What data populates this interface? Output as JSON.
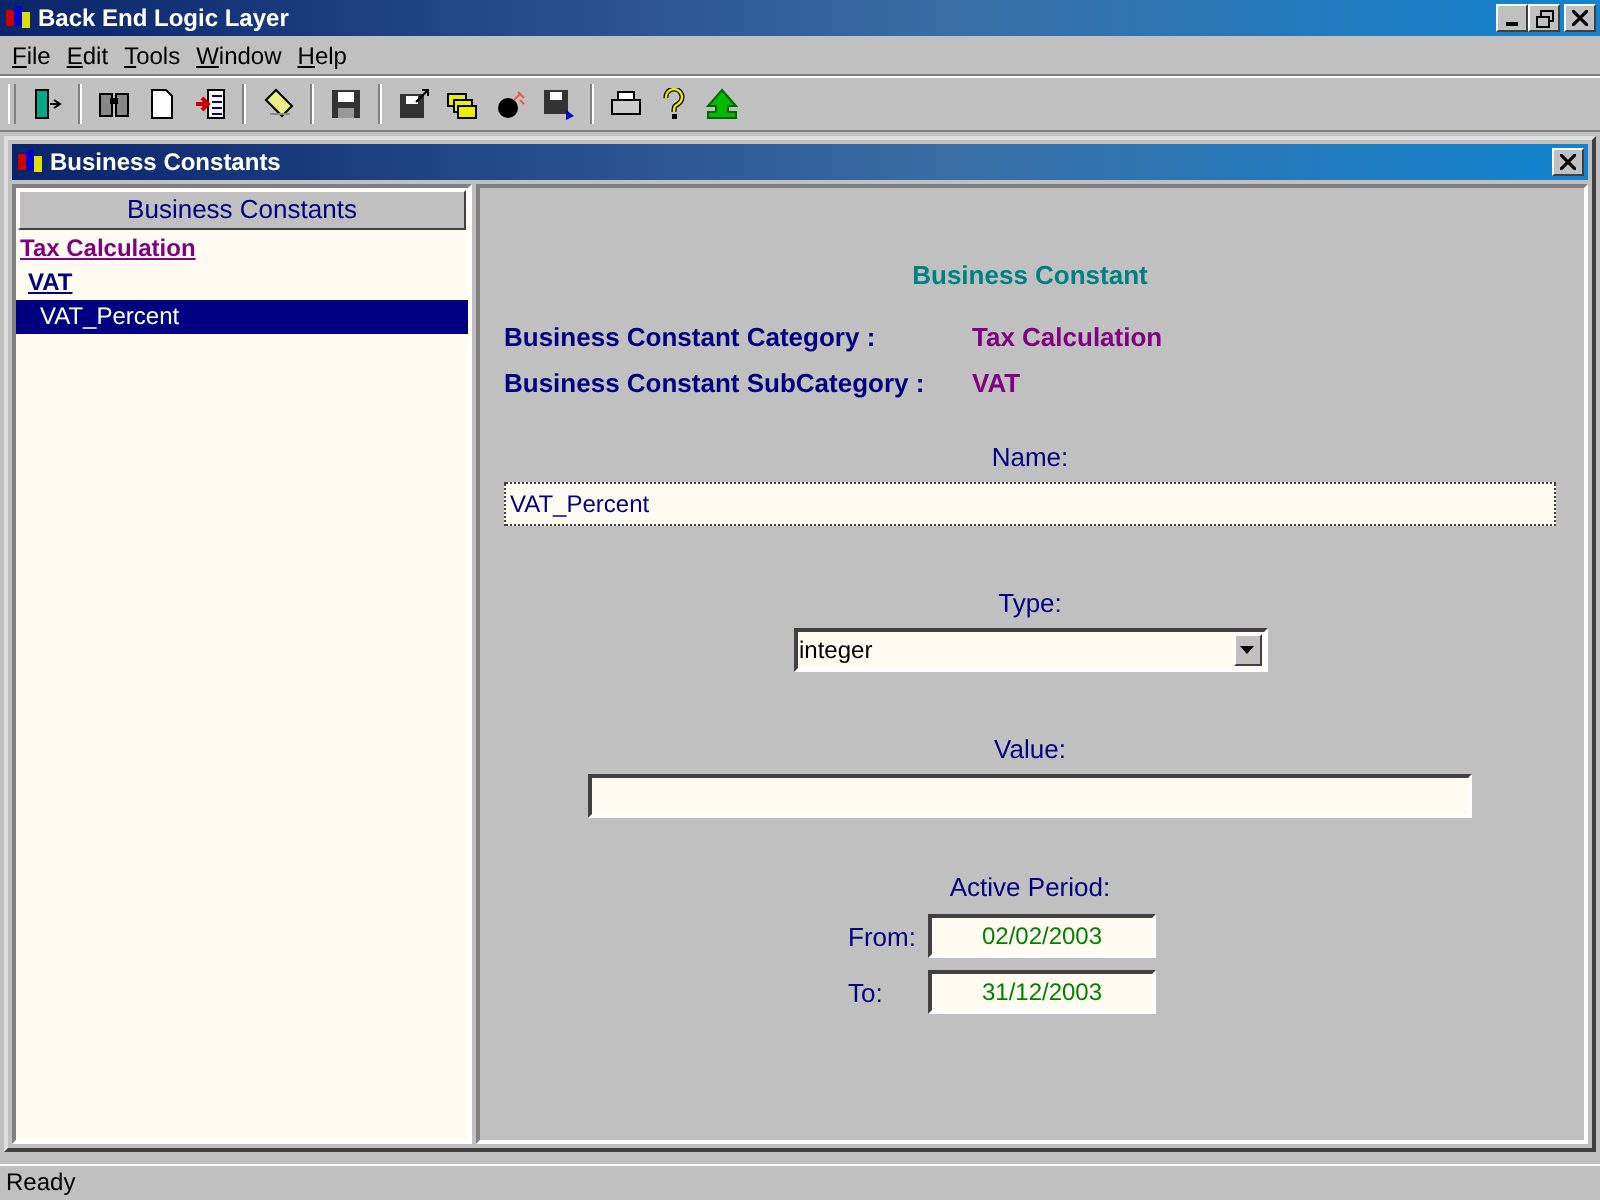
{
  "window": {
    "title": "Back End Logic Layer"
  },
  "menu": [
    {
      "label": "File"
    },
    {
      "label": "Edit"
    },
    {
      "label": "Tools"
    },
    {
      "label": "Window"
    },
    {
      "label": "Help"
    }
  ],
  "child_window": {
    "title": "Business Constants"
  },
  "tree": {
    "header": "Business Constants",
    "items": [
      {
        "label": "Tax Calculation",
        "selected": false,
        "children": [
          {
            "label": "VAT",
            "selected": false,
            "children": [
              {
                "label": "VAT_Percent",
                "selected": true
              }
            ]
          }
        ]
      }
    ]
  },
  "form": {
    "heading": "Business Constant",
    "details": [
      {
        "label": "Business Constant Category :",
        "value": "Tax Calculation"
      },
      {
        "label": "Business Constant SubCategory :",
        "value": "VAT"
      }
    ],
    "name": {
      "label": "Name:",
      "value": "VAT_Percent"
    },
    "type": {
      "label": "Type:",
      "value": "integer"
    },
    "value": {
      "label": "Value:"
    },
    "active_period": {
      "label": "Active Period:",
      "from_label": "From:",
      "from": "02/02/2003",
      "to_label": "To:",
      "to": "31/12/2003"
    }
  },
  "status_bar": "Ready"
}
